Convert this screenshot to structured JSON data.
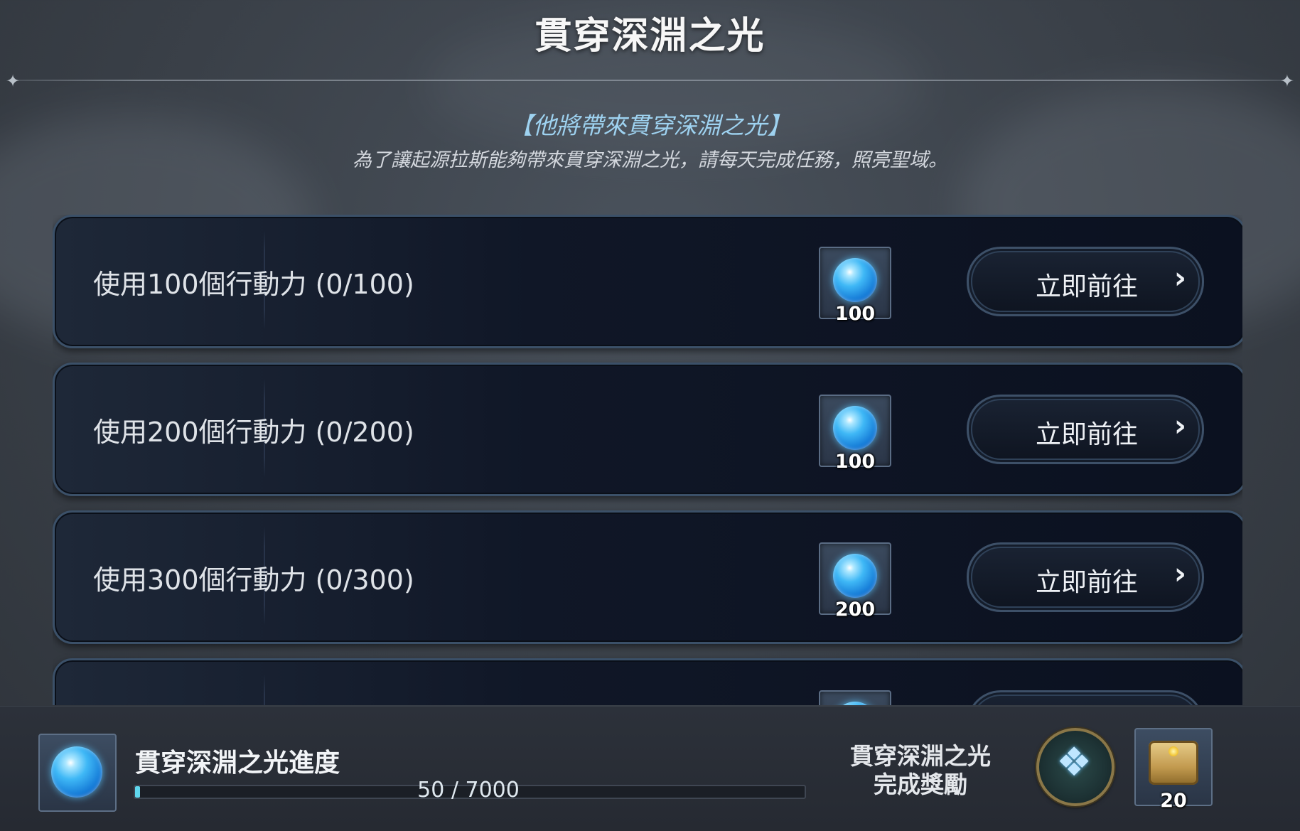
{
  "header": {
    "title": "貫穿深淵之光",
    "subtitle": "【他將帶來貫穿深淵之光】",
    "description": "為了讓起源拉斯能夠帶來貫穿深淵之光，請每天完成任務，照亮聖域。"
  },
  "tasks": [
    {
      "label": "使用100個行動力 (0/100)",
      "reward_icon": "blue-orb-icon",
      "reward_qty": "100",
      "button": "立即前往",
      "button_icon": "chevron-right-icon"
    },
    {
      "label": "使用200個行動力 (0/200)",
      "reward_icon": "blue-orb-icon",
      "reward_qty": "100",
      "button": "立即前往",
      "button_icon": "chevron-right-icon"
    },
    {
      "label": "使用300個行動力 (0/300)",
      "reward_icon": "blue-orb-icon",
      "reward_qty": "200",
      "button": "立即前往",
      "button_icon": "chevron-right-icon"
    }
  ],
  "progress": {
    "icon": "blue-orb-icon",
    "title": "貫穿深淵之光進度",
    "current": 50,
    "max": 7000,
    "text": "50 / 7000",
    "fill_fraction": 0.007
  },
  "completion_reward": {
    "label_line1": "貫穿深淵之光",
    "label_line2": "完成獎勵",
    "emblem_icon": "crystal-emblem-icon",
    "chest_icon": "treasure-chest-icon",
    "chest_qty": "20"
  },
  "colors": {
    "accent_blue": "#9ed2f0",
    "progress_fill": "#5fd7ee",
    "panel_border": "#3b5068"
  }
}
